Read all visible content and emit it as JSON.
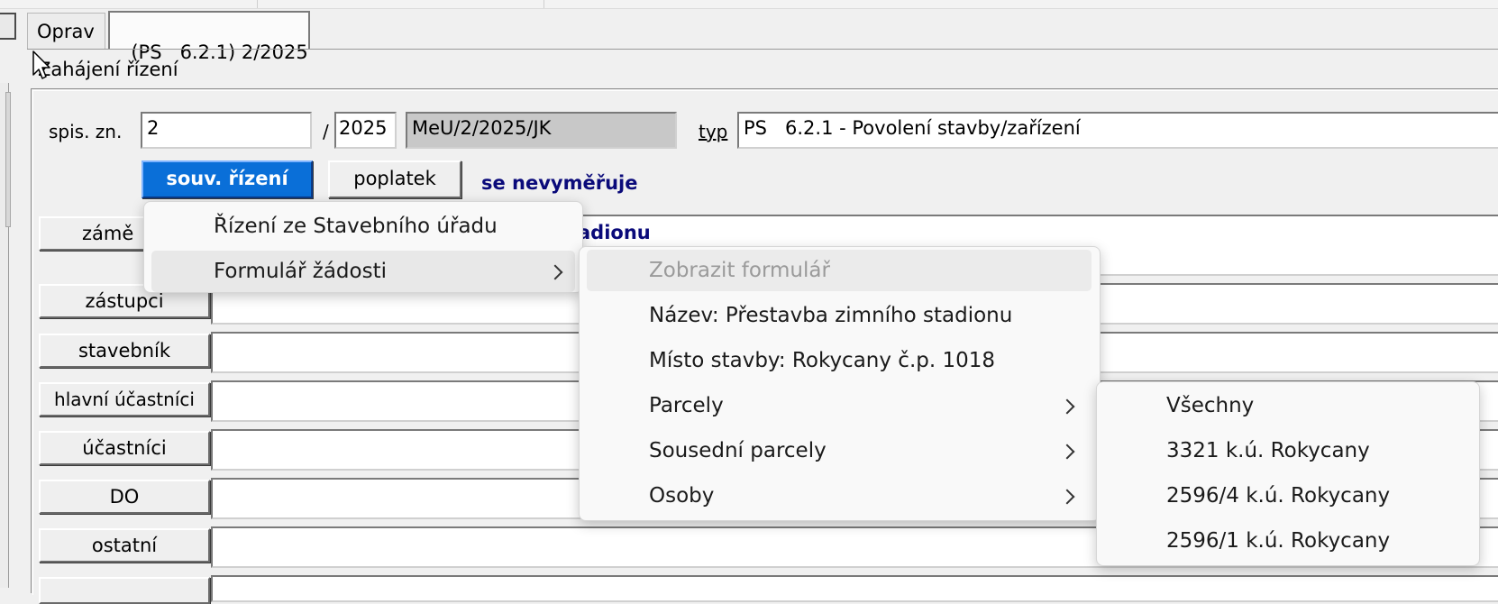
{
  "tabs": [
    {
      "label": "Oprav"
    },
    {
      "label": "(PS   6.2.1) 2/2025"
    }
  ],
  "section": {
    "title": "Zahájení řízení"
  },
  "spis": {
    "label": "spis. zn.",
    "number": "2",
    "separator": "/",
    "year": "2025",
    "reference": "MeU/2/2025/JK",
    "typ_label": "typ",
    "typ_value": "PS   6.2.1 - Povolení stavby/zařízení"
  },
  "actions": {
    "souv_button": "souv. řízení",
    "poplatek_button": "poplatek",
    "poplatek_note": "se nevyměřuje"
  },
  "form": {
    "zamer_label": "zámě",
    "zamer_value_visible": "adionu",
    "rows": [
      {
        "label": "zástupci",
        "value": ""
      },
      {
        "label": "stavebník",
        "value": ""
      },
      {
        "label": "hlavní účastníci",
        "value": ""
      },
      {
        "label": "účastníci",
        "value": ""
      },
      {
        "label": "DO",
        "value": ""
      },
      {
        "label": "ostatní",
        "value": ""
      }
    ]
  },
  "menu1": {
    "items": [
      {
        "label": "Řízení ze Stavebního úřadu",
        "submenu": false
      },
      {
        "label": "Formulář žádosti",
        "submenu": true,
        "highlighted": true
      }
    ]
  },
  "menu2": {
    "items": [
      {
        "label": "Zobrazit formulář",
        "disabled": true
      },
      {
        "label": "Název: Přestavba zimního stadionu"
      },
      {
        "label": "Místo stavby: Rokycany č.p. 1018"
      },
      {
        "label": "Parcely",
        "submenu": true
      },
      {
        "label": "Sousední parcely",
        "submenu": true
      },
      {
        "label": "Osoby",
        "submenu": true
      }
    ]
  },
  "menu3": {
    "items": [
      {
        "label": "Všechny"
      },
      {
        "label": "3321 k.ú. Rokycany"
      },
      {
        "label": "2596/4 k.ú. Rokycany"
      },
      {
        "label": "2596/1 k.ú. Rokycany"
      }
    ]
  },
  "colors": {
    "accent_blue": "#0a6fd8",
    "note_navy": "#0a0a7a"
  }
}
